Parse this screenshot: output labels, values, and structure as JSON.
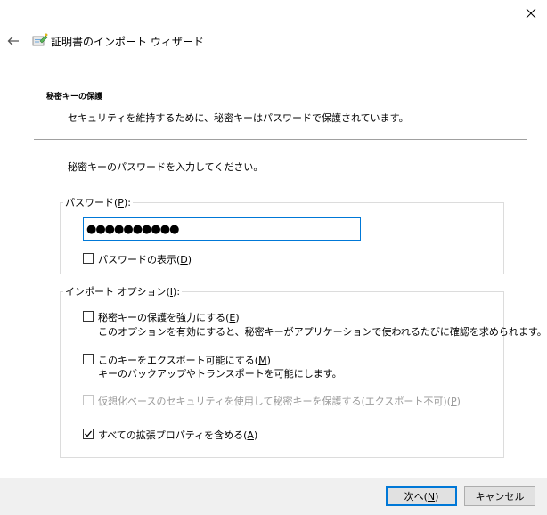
{
  "window": {
    "title": "証明書のインポート ウィザード"
  },
  "page": {
    "heading": "秘密キーの保護",
    "description": "セキュリティを維持するために、秘密キーはパスワードで保護されています。",
    "instruction": "秘密キーのパスワードを入力してください。"
  },
  "password_group": {
    "legend_text": "パスワード(",
    "legend_key": "P",
    "legend_suffix": "):",
    "input_value": "●●●●●●●●●●",
    "show_password": {
      "text": "パスワードの表示(",
      "key": "D",
      "suffix": ")",
      "checked": false
    }
  },
  "options_group": {
    "legend_text": "インポート オプション(",
    "legend_key": "I",
    "legend_suffix": "):",
    "options": [
      {
        "text": "秘密キーの保護を強力にする(",
        "key": "E",
        "suffix": ")",
        "description": "このオプションを有効にすると、秘密キーがアプリケーションで使われるたびに確認を求められます。",
        "checked": false,
        "enabled": true
      },
      {
        "text": "このキーをエクスポート可能にする(",
        "key": "M",
        "suffix": ")",
        "description": "キーのバックアップやトランスポートを可能にします。",
        "checked": false,
        "enabled": true
      },
      {
        "text": "仮想化ベースのセキュリティを使用して秘密キーを保護する(エクスポート不可)(",
        "key": "P",
        "suffix": ")",
        "checked": false,
        "enabled": false
      },
      {
        "text": "すべての拡張プロパティを含める(",
        "key": "A",
        "suffix": ")",
        "checked": true,
        "enabled": true
      }
    ]
  },
  "footer": {
    "next": {
      "text": "次へ(",
      "key": "N",
      "suffix": ")"
    },
    "cancel": {
      "text": "キャンセル"
    }
  },
  "icons": {
    "close": "close-icon",
    "back": "back-arrow-icon",
    "wizard": "certificate-wizard-icon",
    "check": "check-icon"
  },
  "colors": {
    "accent": "#0078d7",
    "divider": "#a0a0a0",
    "footer_bg": "#f0f0f0",
    "disabled_text": "#9a9a9a"
  }
}
